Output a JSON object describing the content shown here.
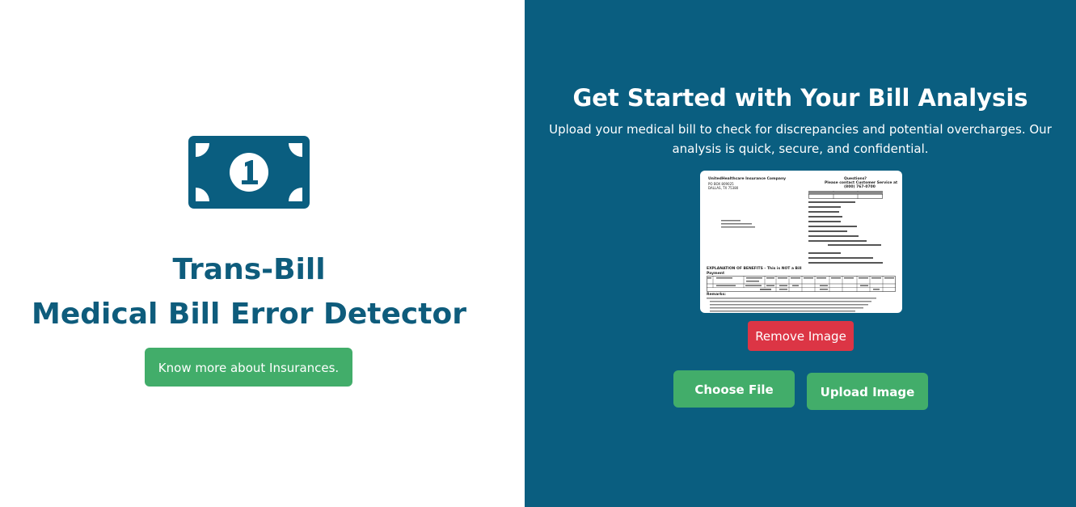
{
  "left": {
    "icon": "dollar-bill-one-icon",
    "title_line1": "Trans-Bill",
    "title_line2": "Medical Bill Error Detector",
    "insurance_button": "Know more about Insurances."
  },
  "right": {
    "heading": "Get Started with Your Bill Analysis",
    "description": "Upload your medical bill to check for discrepancies and potential overcharges. Our analysis is quick, secure, and confidential.",
    "preview": {
      "company": "UnitedHealthcare Insurance Company",
      "address1": "PO BOX 809025",
      "address2": "DALLAS, TX 75380",
      "questions": "Questions?",
      "contact": "Please contact Customer Service at",
      "phone": "(800) 767-0700",
      "explanation": "EXPLANATION OF BENEFITS - This is NOT a Bill",
      "payment": "Payment",
      "remarks": "Remarks:",
      "table_headers": [
        "Ref #",
        "Service",
        "Dates of Service",
        "Proc Code",
        "Amount Charged",
        "Ineligible",
        "Deductible",
        "Total Allowed",
        "Co-Pay",
        "Policy Reduction",
        "Total Benefits",
        "Patient Balance",
        "Remark Code"
      ],
      "row_service": "LABORATORY",
      "row_totals": "Totals:"
    },
    "remove_button": "Remove Image",
    "choose_button": "Choose File",
    "upload_button": "Upload Image"
  },
  "colors": {
    "brand_blue": "#0a5e80",
    "title_blue": "#0e5c7c",
    "green": "#42ad6a",
    "red": "#dc3545"
  }
}
